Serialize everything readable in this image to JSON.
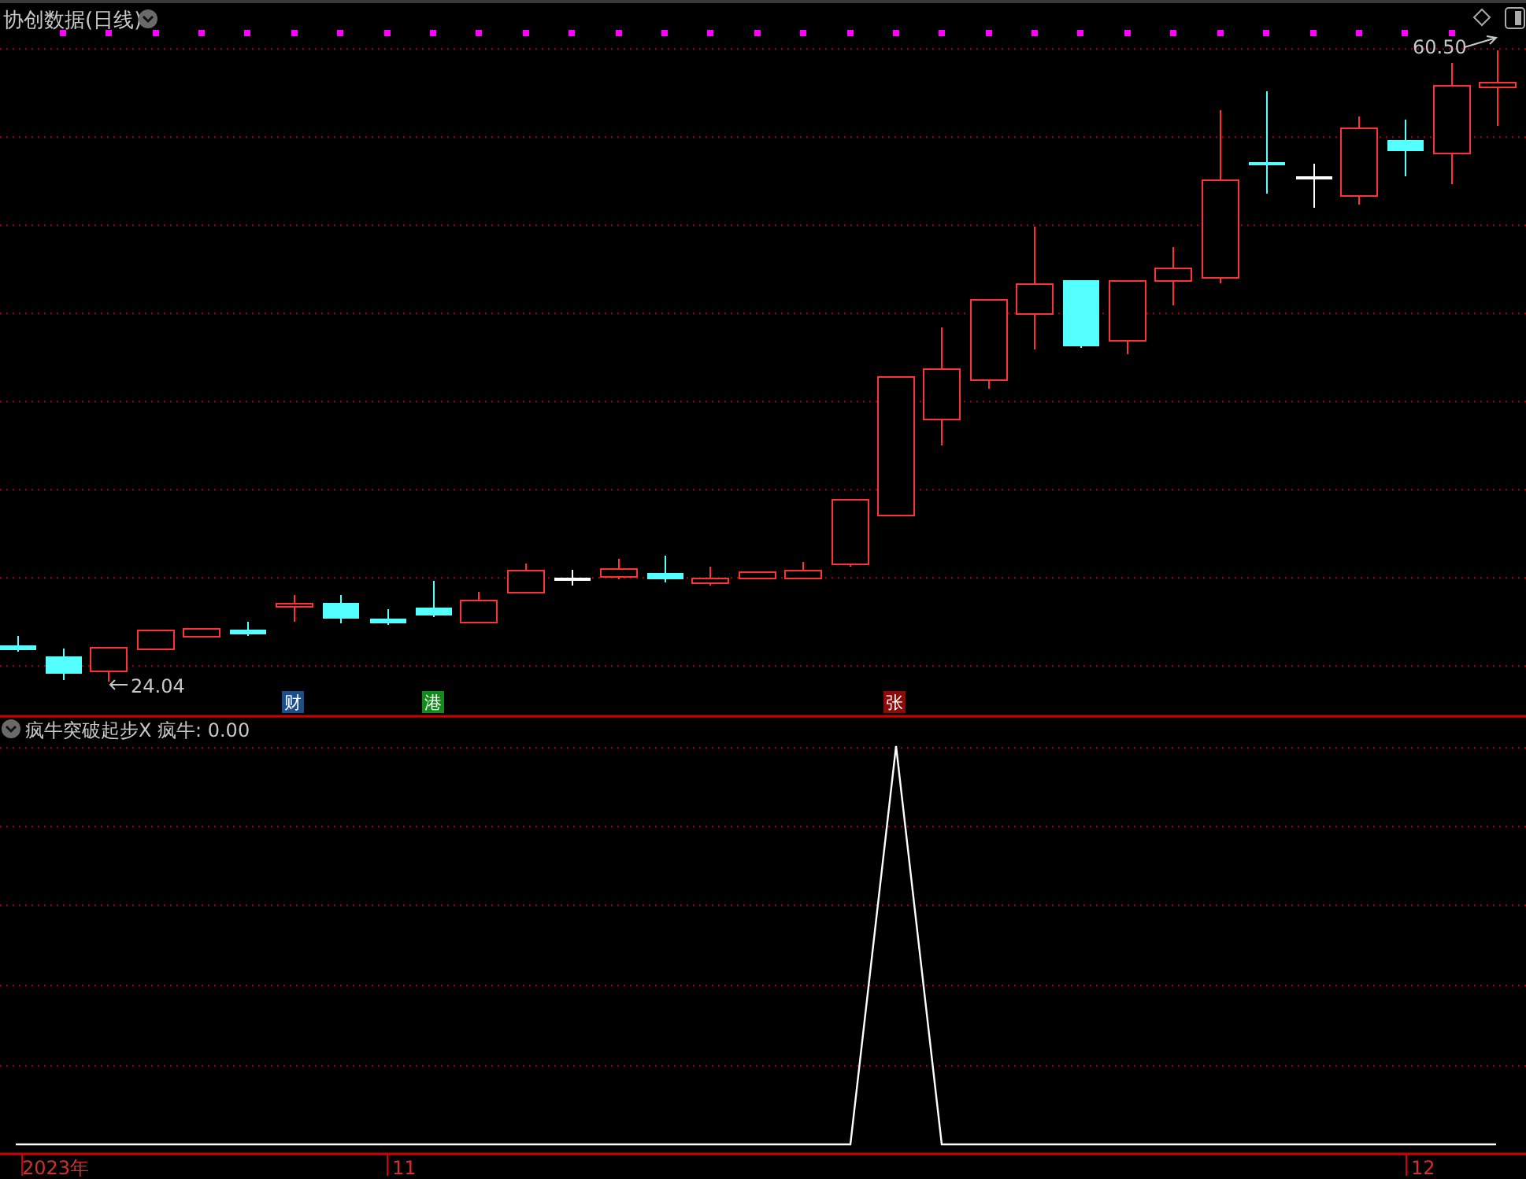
{
  "main_chart": {
    "title": "协创数据(日线)",
    "high_label": "60.50",
    "low_label": "24.04",
    "event_tags": [
      {
        "text": "财",
        "color": "#1c4f8a"
      },
      {
        "text": "港",
        "color": "#138a1c"
      },
      {
        "text": "张",
        "color": "#8c0a0a"
      }
    ]
  },
  "indicator": {
    "name": "疯牛突破起步X",
    "reading": "疯牛: 0.00"
  },
  "time_axis": {
    "labels": [
      "2023年",
      "11",
      "12"
    ]
  }
}
